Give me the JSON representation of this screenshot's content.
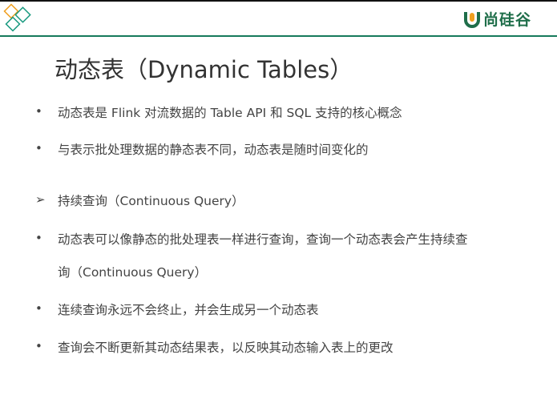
{
  "slide": {
    "title": "动态表（Dynamic Tables）",
    "brand": "尚硅谷",
    "colors": {
      "accent": "#167a5b",
      "orange": "#f0a020",
      "teal": "#1a9a80"
    },
    "items": [
      {
        "bullet": "•",
        "text": "动态表是 Flink 对流数据的 Table API 和 SQL 支持的核心概念"
      },
      {
        "bullet": "•",
        "text": "与表示批处理数据的静态表不同，动态表是随时间变化的"
      },
      {
        "bullet": "➢",
        "text": "持续查询（Continuous Query）"
      },
      {
        "bullet": "•",
        "text": "动态表可以像静态的批处理表一样进行查询，查询一个动态表会产生持续查"
      },
      {
        "bullet": "",
        "text": "询（Continuous Query）"
      },
      {
        "bullet": "•",
        "text": "连续查询永远不会终止，并会生成另一个动态表"
      },
      {
        "bullet": "•",
        "text": "查询会不断更新其动态结果表，以反映其动态输入表上的更改"
      }
    ]
  }
}
